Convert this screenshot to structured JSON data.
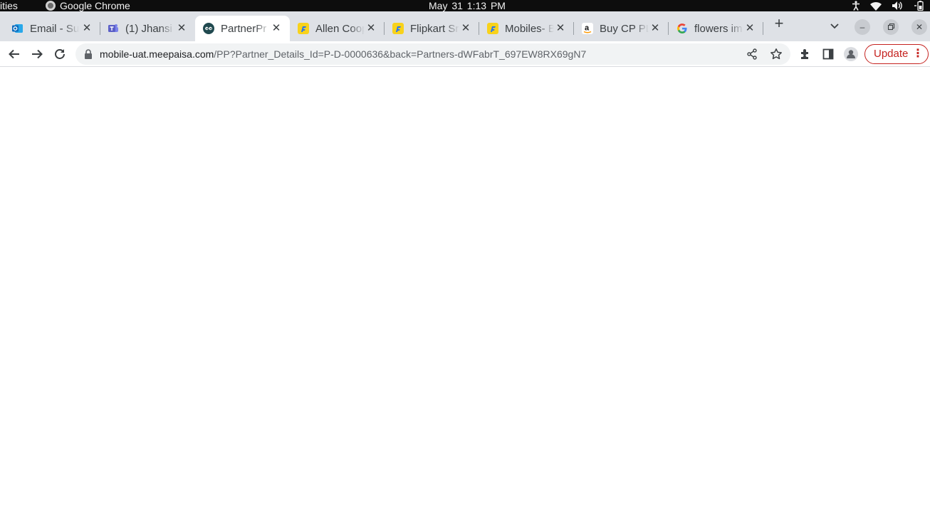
{
  "system_bar": {
    "activities": "ities",
    "app_name": "Google Chrome",
    "clock": "May 31  1:13 PM",
    "tray_icons": [
      "accessibility-icon",
      "wifi-icon",
      "volume-icon",
      "battery-icon"
    ]
  },
  "tabs": [
    {
      "title": "Email - Sul",
      "favicon": "outlook-icon",
      "active": false
    },
    {
      "title": "(1) Jhansi",
      "favicon": "teams-icon",
      "active": false
    },
    {
      "title": "PartnerPr",
      "favicon": "meepaisa-icon",
      "active": true
    },
    {
      "title": "Allen Coop",
      "favicon": "flipkart-icon",
      "active": false
    },
    {
      "title": "Flipkart Sr",
      "favicon": "flipkart-icon",
      "active": false
    },
    {
      "title": "Mobiles- B",
      "favicon": "flipkart-icon",
      "active": false
    },
    {
      "title": "Buy CP PL",
      "favicon": "amazon-icon",
      "active": false
    },
    {
      "title": "flowers im",
      "favicon": "google-icon",
      "active": false
    }
  ],
  "toolbar": {
    "url_host": "mobile-uat.meepaisa.com",
    "url_path": "/PP?Partner_Details_Id=P-D-0000636&back=Partners-dWFabrT_697EW8RX69gN7",
    "update_label": "Update",
    "menu_label": "⋮"
  },
  "colors": {
    "tab_strip": "#dee1e6",
    "update_red": "#c5221f",
    "flipkart_yellow": "#f8d21b",
    "teams_purple": "#5b5fc7",
    "outlook_blue": "#0f6cbd"
  }
}
